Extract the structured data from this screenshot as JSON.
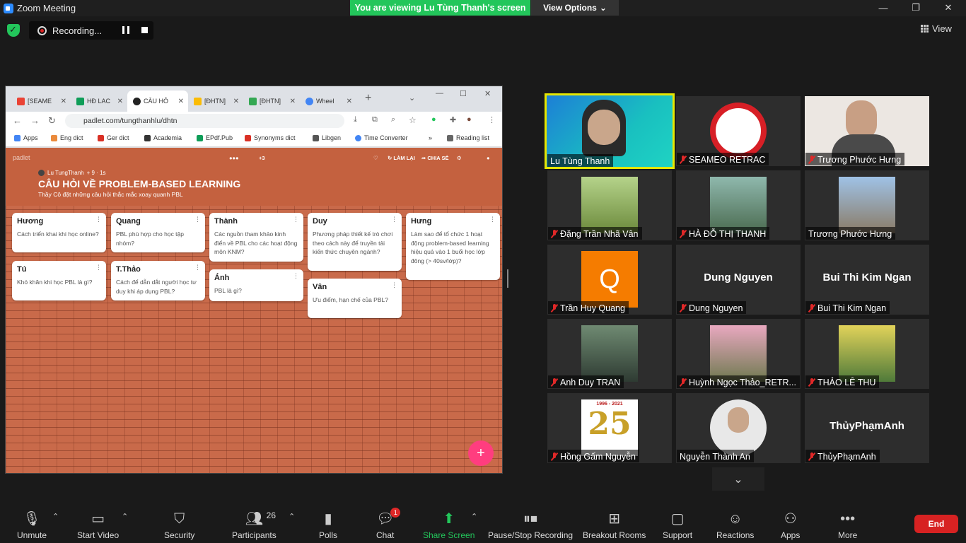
{
  "window": {
    "title": "Zoom Meeting",
    "banner": "You are viewing Lu Tùng Thanh's screen",
    "view_options": "View Options"
  },
  "recording": {
    "label": "Recording..."
  },
  "view_button": "View",
  "browser": {
    "tabs": [
      {
        "label": "[SEAME",
        "color": "#ea4335"
      },
      {
        "label": "HĐ LAC",
        "color": "#0f9d58"
      },
      {
        "label": "CÂU HỎ",
        "color": "#222222"
      },
      {
        "label": "[ĐHTN]",
        "color": "#fbbc05"
      },
      {
        "label": "[ĐHTN]",
        "color": "#34a853"
      },
      {
        "label": "Wheel",
        "color": "#4285f4"
      }
    ],
    "url": "padlet.com/tungthanhlu/dhtn",
    "bookmarks": [
      "Apps",
      "Eng dict",
      "Ger dict",
      "Academia",
      "EPdf.Pub",
      "Synonyms dict",
      "Libgen",
      "Time Converter",
      "Reading list"
    ]
  },
  "padlet": {
    "logo": "padlet",
    "author": "Lu TungThanh",
    "meta": "+ 9 · 1s",
    "title": "CÂU HỎI VỀ PROBLEM-BASED LEARNING",
    "subtitle": "Thầy Cô đặt những câu hỏi thắc mắc xoay quanh PBL",
    "remake": "LÀM LẠI",
    "share": "CHIA SẺ",
    "viewers": "+3",
    "cards": [
      {
        "name": "Hương",
        "body": "Cách triển khai khi học online?"
      },
      {
        "name": "Quang",
        "body": "PBL phù hợp cho học tập nhóm?"
      },
      {
        "name": "Thành",
        "body": " Các nguồn tham khảo kinh điển về PBL cho các hoạt động môn KNM?"
      },
      {
        "name": "Duy",
        "body": "Phương pháp thiết kế trò chơi theo cách này để truyền tải kiến thức chuyên ngành?"
      },
      {
        "name": "Hưng",
        "body": "Làm sao để tổ chức 1 hoạt động problem-based learning hiệu quả vào 1 buổi học lớp đông (> 40sv/lớp)?"
      },
      {
        "name": "Tú",
        "body": "Khó khăn khi học PBL là gì?"
      },
      {
        "name": "T.Thảo",
        "body": "Cách để dẫn dắt người học tư duy khi áp dụng PBL?"
      },
      {
        "name": "Ánh",
        "body": "PBL là gì?"
      },
      {
        "name": "Vân",
        "body": "Ưu điểm, hạn chế của PBL?"
      }
    ]
  },
  "participants": [
    {
      "name": "Lu Tùng Thanh",
      "muted": false,
      "big": ""
    },
    {
      "name": "SEAMEO RETRAC",
      "muted": true,
      "big": ""
    },
    {
      "name": "Trương Phước Hưng",
      "muted": true,
      "big": ""
    },
    {
      "name": "Đặng Trần Nhã Vân",
      "muted": true,
      "big": ""
    },
    {
      "name": "HÀ ĐỖ THỊ THANH",
      "muted": true,
      "big": ""
    },
    {
      "name": "Trương Phước Hưng",
      "muted": false,
      "big": ""
    },
    {
      "name": "Trần Huy Quang",
      "muted": true,
      "big": ""
    },
    {
      "name": "Dung Nguyen",
      "muted": true,
      "big": "Dung Nguyen"
    },
    {
      "name": "Bui Thi Kim Ngan",
      "muted": true,
      "big": "Bui Thi Kim Ngan"
    },
    {
      "name": "Anh Duy TRAN",
      "muted": true,
      "big": ""
    },
    {
      "name": "Huỳnh Ngọc Thảo_RETR...",
      "muted": true,
      "big": ""
    },
    {
      "name": "THẢO LÊ THU",
      "muted": true,
      "big": ""
    },
    {
      "name": "Hồng Gấm Nguyễn",
      "muted": true,
      "big": ""
    },
    {
      "name": "Nguyễn Thành An",
      "muted": false,
      "big": ""
    },
    {
      "name": "ThủyPhạmAnh",
      "muted": true,
      "big": "ThủyPhạmAnh"
    }
  ],
  "avatar_letter": "Q",
  "logo_25_text": "1996 - 2021",
  "toolbar": {
    "unmute": "Unmute",
    "start_video": "Start Video",
    "security": "Security",
    "participants": "Participants",
    "participants_count": "26",
    "polls": "Polls",
    "chat": "Chat",
    "chat_badge": "1",
    "share_screen": "Share Screen",
    "pause_recording": "Pause/Stop Recording",
    "breakout": "Breakout Rooms",
    "support": "Support",
    "reactions": "Reactions",
    "apps": "Apps",
    "more": "More",
    "end": "End"
  }
}
